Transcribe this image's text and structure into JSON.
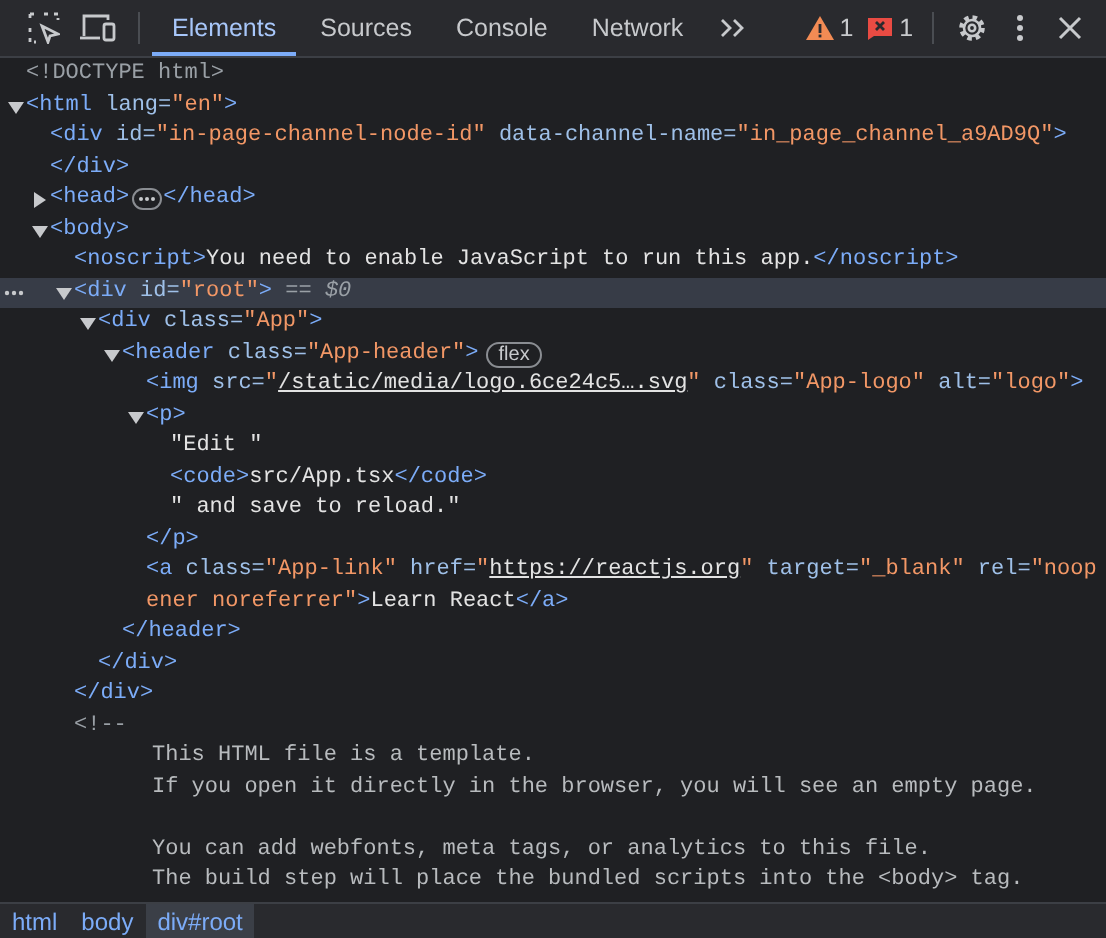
{
  "toolbar": {
    "tabs": [
      {
        "label": "Elements",
        "selected": true
      },
      {
        "label": "Sources",
        "selected": false
      },
      {
        "label": "Console",
        "selected": false
      },
      {
        "label": "Network",
        "selected": false
      }
    ],
    "issues": [
      {
        "kind": "warning",
        "count": "1"
      },
      {
        "kind": "error",
        "count": "1"
      }
    ]
  },
  "tree": [
    {
      "selected": false,
      "segments": [
        {
          "kind": "muted",
          "text": "<!DOCTYPE html>"
        }
      ]
    },
    {
      "selected": false,
      "expanded": true,
      "segments": [
        {
          "kind": "tag",
          "text": "<html"
        },
        {
          "kind": "attr",
          "text": " lang="
        },
        {
          "kind": "value",
          "text": "\"en\""
        },
        {
          "kind": "tag",
          "text": ">"
        }
      ],
      "children": [
        {
          "selected": false,
          "segments": [
            {
              "kind": "tag",
              "text": "<div"
            },
            {
              "kind": "attr",
              "text": " id="
            },
            {
              "kind": "value",
              "text": "\"in-page-channel-node-id\""
            },
            {
              "kind": "attr",
              "text": " data-channel-name="
            },
            {
              "kind": "value",
              "text": "\"in_page_channel_a9AD9Q\""
            },
            {
              "kind": "tag",
              "text": ">"
            }
          ],
          "closing": [
            {
              "kind": "tag",
              "text": "</div>"
            }
          ]
        },
        {
          "selected": false,
          "expanded": false,
          "segments": [
            {
              "kind": "tag",
              "text": "<head>"
            },
            {
              "kind": "ellipsis"
            },
            {
              "kind": "tag",
              "text": "</head>"
            }
          ]
        },
        {
          "selected": false,
          "expanded": true,
          "segments": [
            {
              "kind": "tag",
              "text": "<body>"
            }
          ],
          "children": [
            {
              "selected": false,
              "segments": [
                {
                  "kind": "tag",
                  "text": "<noscript>"
                },
                {
                  "kind": "text",
                  "text": "You need to enable JavaScript to run this app."
                },
                {
                  "kind": "tag",
                  "text": "</noscript>"
                }
              ]
            },
            {
              "selected": true,
              "expanded": true,
              "segments": [
                {
                  "kind": "tag",
                  "text": "<div"
                },
                {
                  "kind": "attr",
                  "text": " id="
                },
                {
                  "kind": "value",
                  "text": "\"root\""
                },
                {
                  "kind": "tag",
                  "text": ">"
                },
                {
                  "kind": "muted",
                  "text": " == "
                },
                {
                  "kind": "ref",
                  "text": "$0"
                }
              ],
              "children": [
                {
                  "selected": false,
                  "expanded": true,
                  "segments": [
                    {
                      "kind": "tag",
                      "text": "<div"
                    },
                    {
                      "kind": "attr",
                      "text": " class="
                    },
                    {
                      "kind": "value",
                      "text": "\"App\""
                    },
                    {
                      "kind": "tag",
                      "text": ">"
                    }
                  ],
                  "children": [
                    {
                      "selected": false,
                      "expanded": true,
                      "segments": [
                        {
                          "kind": "tag",
                          "text": "<header"
                        },
                        {
                          "kind": "attr",
                          "text": " class="
                        },
                        {
                          "kind": "value",
                          "text": "\"App-header\""
                        },
                        {
                          "kind": "tag",
                          "text": ">"
                        },
                        {
                          "kind": "badge",
                          "text": "flex"
                        }
                      ],
                      "children": [
                        {
                          "selected": false,
                          "segments": [
                            {
                              "kind": "tag",
                              "text": "<img"
                            },
                            {
                              "kind": "attr",
                              "text": " src="
                            },
                            {
                              "kind": "value",
                              "text": "\""
                            },
                            {
                              "kind": "link",
                              "text": "/static/media/logo.6ce24c5….svg"
                            },
                            {
                              "kind": "value",
                              "text": "\""
                            },
                            {
                              "kind": "attr",
                              "text": " class="
                            },
                            {
                              "kind": "value",
                              "text": "\"App-logo\""
                            },
                            {
                              "kind": "attr",
                              "text": " alt="
                            },
                            {
                              "kind": "value",
                              "text": "\"logo\""
                            },
                            {
                              "kind": "tag",
                              "text": ">"
                            }
                          ]
                        },
                        {
                          "selected": false,
                          "expanded": true,
                          "segments": [
                            {
                              "kind": "tag",
                              "text": "<p>"
                            }
                          ],
                          "children": [
                            {
                              "selected": false,
                              "segments": [
                                {
                                  "kind": "text",
                                  "text": "\"Edit \""
                                }
                              ]
                            },
                            {
                              "selected": false,
                              "segments": [
                                {
                                  "kind": "tag",
                                  "text": "<code>"
                                },
                                {
                                  "kind": "text",
                                  "text": "src/App.tsx"
                                },
                                {
                                  "kind": "tag",
                                  "text": "</code>"
                                }
                              ]
                            },
                            {
                              "selected": false,
                              "segments": [
                                {
                                  "kind": "text",
                                  "text": "\" and save to reload.\""
                                }
                              ]
                            }
                          ],
                          "closing": [
                            {
                              "kind": "tag",
                              "text": "</p>"
                            }
                          ]
                        },
                        {
                          "selected": false,
                          "segments": [
                            {
                              "kind": "tag",
                              "text": "<a"
                            },
                            {
                              "kind": "attr",
                              "text": " class="
                            },
                            {
                              "kind": "value",
                              "text": "\"App-link\""
                            },
                            {
                              "kind": "attr",
                              "text": " href="
                            },
                            {
                              "kind": "value",
                              "text": "\""
                            },
                            {
                              "kind": "link",
                              "text": "https://reactjs.org"
                            },
                            {
                              "kind": "value",
                              "text": "\""
                            },
                            {
                              "kind": "attr",
                              "text": " target="
                            },
                            {
                              "kind": "value",
                              "text": "\"_blank\""
                            },
                            {
                              "kind": "attr",
                              "text": " rel="
                            },
                            {
                              "kind": "value",
                              "text": "\"noop"
                            }
                          ],
                          "wrapped": [
                            {
                              "kind": "value",
                              "text": "ener noreferrer\""
                            },
                            {
                              "kind": "tag",
                              "text": ">"
                            },
                            {
                              "kind": "text",
                              "text": "Learn React"
                            },
                            {
                              "kind": "tag",
                              "text": "</a>"
                            }
                          ]
                        }
                      ],
                      "closing": [
                        {
                          "kind": "tag",
                          "text": "</header>"
                        }
                      ]
                    }
                  ],
                  "closing": [
                    {
                      "kind": "tag",
                      "text": "</div>"
                    }
                  ]
                }
              ],
              "closing": [
                {
                  "kind": "tag",
                  "text": "</div>"
                }
              ]
            },
            {
              "selected": false,
              "kind": "comment",
              "segments": [
                {
                  "kind": "muted",
                  "text": "<!--"
                }
              ],
              "paragraphs": [
                [
                  "This HTML file is a template.",
                  "If you open it directly in the browser, you will see an empty page."
                ],
                [
                  "You can add webfonts, meta tags, or analytics to this file.",
                  "The build step will place the bundled scripts into the <body> tag."
                ]
              ]
            }
          ]
        }
      ]
    }
  ],
  "breadcrumbs": [
    {
      "label": "html",
      "selected": false
    },
    {
      "label": "body",
      "selected": false
    },
    {
      "label": "div#root",
      "selected": true
    }
  ]
}
